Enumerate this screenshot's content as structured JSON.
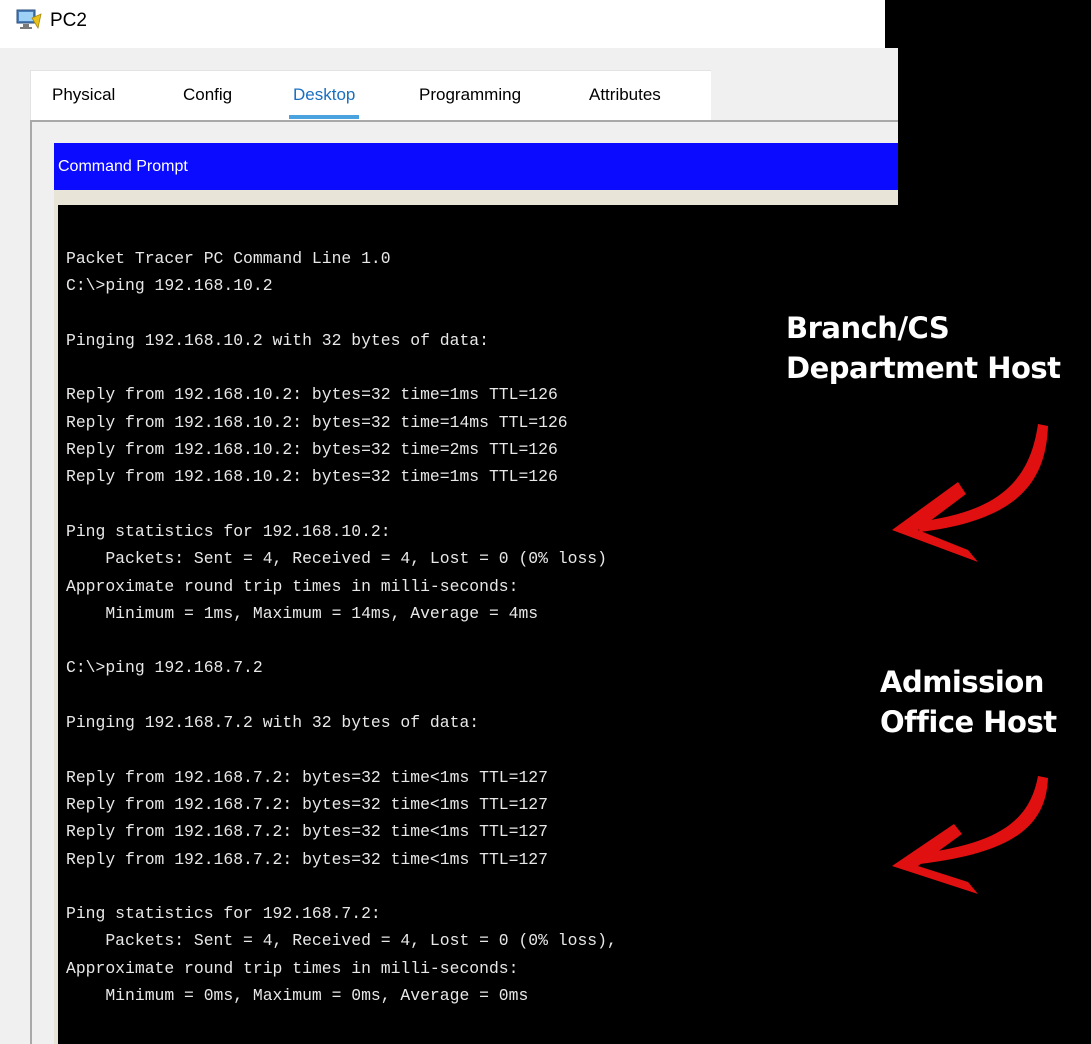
{
  "window": {
    "title": "PC2"
  },
  "tabs": [
    {
      "label": "Physical",
      "active": false
    },
    {
      "label": "Config",
      "active": false
    },
    {
      "label": "Desktop",
      "active": true
    },
    {
      "label": "Programming",
      "active": false
    },
    {
      "label": "Attributes",
      "active": false
    }
  ],
  "command_prompt": {
    "title": "Command Prompt",
    "lines": [
      "Packet Tracer PC Command Line 1.0",
      "C:\\>ping 192.168.10.2",
      "",
      "Pinging 192.168.10.2 with 32 bytes of data:",
      "",
      "Reply from 192.168.10.2: bytes=32 time=1ms TTL=126",
      "Reply from 192.168.10.2: bytes=32 time=14ms TTL=126",
      "Reply from 192.168.10.2: bytes=32 time=2ms TTL=126",
      "Reply from 192.168.10.2: bytes=32 time=1ms TTL=126",
      "",
      "Ping statistics for 192.168.10.2:",
      "    Packets: Sent = 4, Received = 4, Lost = 0 (0% loss)",
      "Approximate round trip times in milli-seconds:",
      "    Minimum = 1ms, Maximum = 14ms, Average = 4ms",
      "",
      "C:\\>ping 192.168.7.2",
      "",
      "Pinging 192.168.7.2 with 32 bytes of data:",
      "",
      "Reply from 192.168.7.2: bytes=32 time<1ms TTL=127",
      "Reply from 192.168.7.2: bytes=32 time<1ms TTL=127",
      "Reply from 192.168.7.2: bytes=32 time<1ms TTL=127",
      "Reply from 192.168.7.2: bytes=32 time<1ms TTL=127",
      "",
      "Ping statistics for 192.168.7.2:",
      "    Packets: Sent = 4, Received = 4, Lost = 0 (0% loss),",
      "Approximate round trip times in milli-seconds:",
      "    Minimum = 0ms, Maximum = 0ms, Average = 0ms"
    ]
  },
  "annotations": {
    "first": {
      "line1": "Branch/CS",
      "line2": "Department Host"
    },
    "second": {
      "line1": "Admission",
      "line2": "Office Host"
    },
    "arrow_color": "#e01010"
  },
  "colors": {
    "header_blue": "#0b0bff",
    "tab_active": "#1a6fc1",
    "console_bg": "#000000",
    "console_text": "#e8e8e8"
  }
}
